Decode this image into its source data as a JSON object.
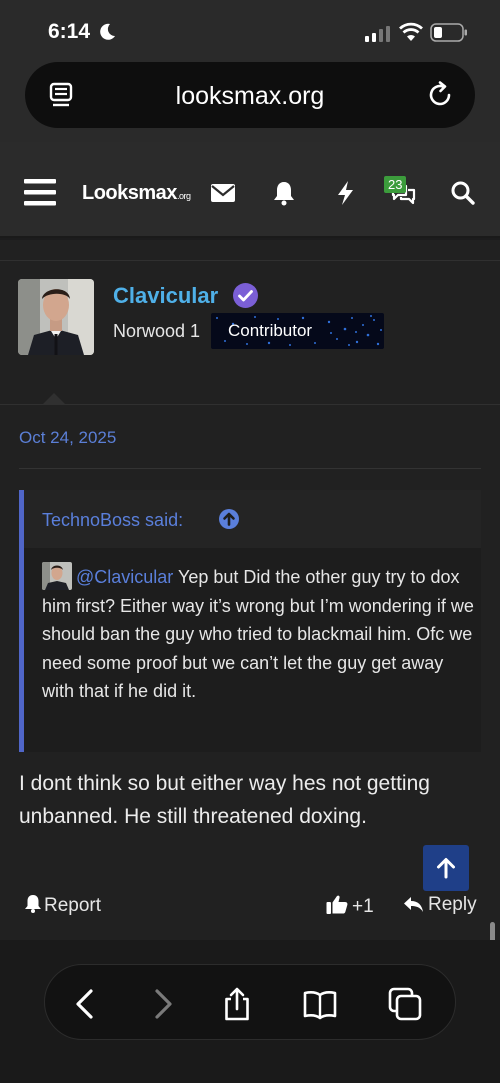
{
  "status_bar": {
    "time": "6:14",
    "icons": [
      "moon-icon",
      "signal-icon",
      "wifi-icon",
      "battery-icon"
    ]
  },
  "browser": {
    "url": "looksmax.org",
    "icons": [
      "reader-icon",
      "reload-icon"
    ]
  },
  "site_nav": {
    "logo_main": "Looksmax",
    "logo_suffix": ".org",
    "conversations_badge": "23",
    "icons": [
      "menu-icon",
      "mail-icon",
      "bell-icon",
      "bolt-icon",
      "chat-icon",
      "search-icon"
    ]
  },
  "post": {
    "username": "Clavicular",
    "user_title": "Norwood 1",
    "user_banner": "Contributor",
    "date": "Oct 24, 2025",
    "quote": {
      "author_line": "TechnoBoss said:",
      "mention": "@Clavicular",
      "text": " Yep but Did the other guy try to dox him first? Either way it’s wrong but I’m wondering if we should ban the guy who tried to blackmail him. Ofc we need some proof but we can’t let the guy get away with that if he did it."
    },
    "body": "I dont think so but either way hes not getting unbanned. He still threatened doxing.",
    "actions": {
      "report": "Report",
      "like": "+1",
      "reply": "Reply"
    }
  },
  "colors": {
    "accent_link": "#5a7fdb",
    "username": "#4fb0e8",
    "verified": "#7b5fd6",
    "quote_border": "#5066c8",
    "scroll_top_button": "#1f3f88"
  }
}
